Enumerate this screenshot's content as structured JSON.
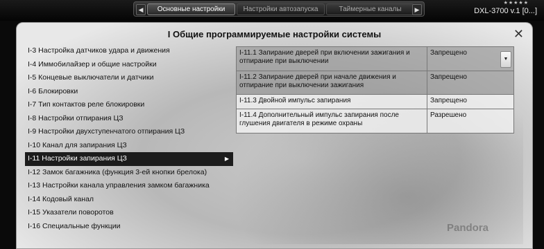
{
  "topbar": {
    "tabs": [
      "Основные настройки",
      "Настройки автозапуска",
      "Таймерные каналы"
    ],
    "device": "DXL-3700 v.1 [0...]"
  },
  "dialog": {
    "title": "I Общие программируемые настройки системы",
    "menu": [
      "I-3 Настройка датчиков удара и движения",
      "I-4 Иммобилайзер и общие настройки",
      "I-5 Концевые выключатели и датчики",
      "I-6 Блокировки",
      "I-7 Тип контактов реле блокировки",
      "I-8 Настройки отпирания ЦЗ",
      "I-9 Настройки двухступенчатого отпирания ЦЗ",
      "I-10 Канал для запирания ЦЗ",
      "I-11 Настройки запирания ЦЗ",
      "I-12 Замок багажника (функция 3-ей кнопки брелока)",
      "I-13 Настройки канала управления замком багажника",
      "I-14 Кодовый канал",
      "I-15 Указатели поворотов",
      "I-16 Специальные функции"
    ],
    "selected_index": 8,
    "settings": [
      {
        "name": "I-11.1 Запирание дверей при включении зажигания и отпирание при выключении",
        "value": "Запрещено"
      },
      {
        "name": "I-11.2 Запирание дверей при начале движения и отпирание при выключении зажигания",
        "value": "Запрещено"
      },
      {
        "name": "I-11.3 Двойной импульс запирания",
        "value": "Запрещено"
      },
      {
        "name": "I-11.4 Дополнительный импульс запирания после глушения двигателя в режиме охраны",
        "value": "Разрешено"
      }
    ],
    "brand": "Pandora"
  }
}
